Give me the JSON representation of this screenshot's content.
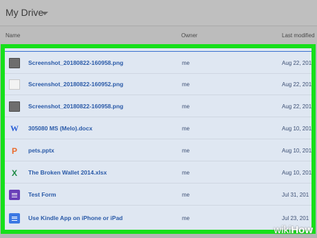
{
  "header": {
    "title": "My Drive"
  },
  "columns": {
    "name": "Name",
    "owner": "Owner",
    "last_modified": "Last modified"
  },
  "files": [
    {
      "name": "Screenshot_20180822-160958.png",
      "owner": "me",
      "date": "Aug 22, 201",
      "icon": "image-icon"
    },
    {
      "name": "Screenshot_20180822-160952.png",
      "owner": "me",
      "date": "Aug 22, 201",
      "icon": "image-icon"
    },
    {
      "name": "Screenshot_20180822-160958.png",
      "owner": "me",
      "date": "Aug 22, 201",
      "icon": "image-icon"
    },
    {
      "name": "305080 MS (Melo).docx",
      "owner": "me",
      "date": "Aug 10, 201",
      "icon": "word-icon"
    },
    {
      "name": "pets.pptx",
      "owner": "me",
      "date": "Aug 10, 201",
      "icon": "powerpoint-icon"
    },
    {
      "name": "The Broken Wallet 2014.xlsx",
      "owner": "me",
      "date": "Aug 10, 201",
      "icon": "excel-icon"
    },
    {
      "name": "Test Form",
      "owner": "me",
      "date": "Jul 31, 201",
      "icon": "forms-icon"
    },
    {
      "name": "Use Kindle App on iPhone or iPad",
      "owner": "me",
      "date": "Jul 23, 201",
      "icon": "docs-icon"
    }
  ],
  "icon_glyphs": {
    "word": "W",
    "powerpoint": "P",
    "excel": "X"
  },
  "watermark": {
    "part1": "wiki",
    "part2": "How"
  },
  "colors": {
    "highlight": "#16e01a",
    "link": "#2a5aa8"
  }
}
